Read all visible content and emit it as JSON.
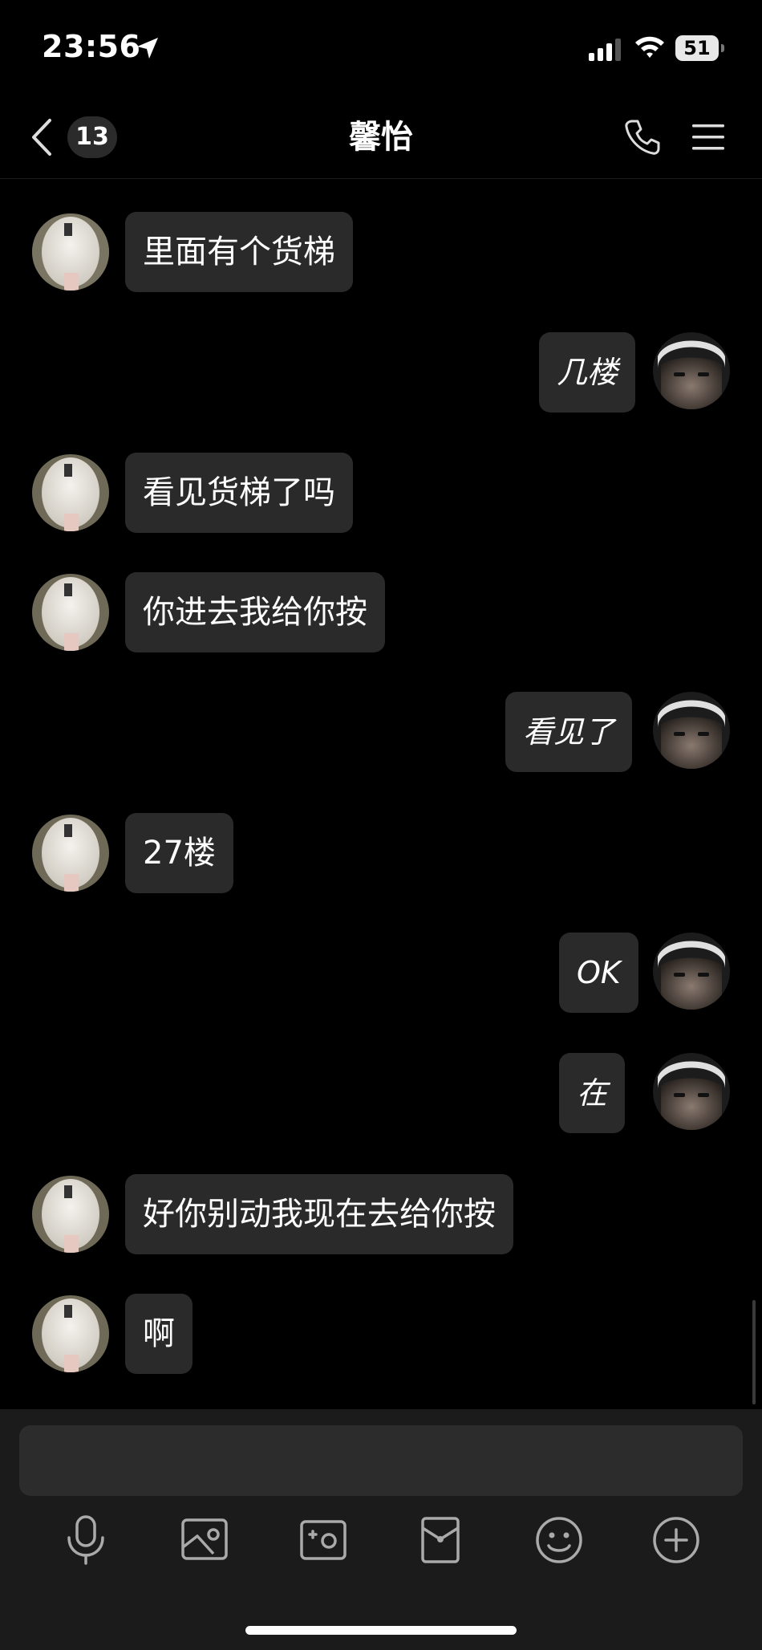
{
  "status_bar": {
    "time": "23:56",
    "battery": "51"
  },
  "nav": {
    "unread_count": "13",
    "title": "馨怡"
  },
  "messages": [
    {
      "side": "left",
      "text": "里面有个货梯"
    },
    {
      "side": "right",
      "text": "几楼"
    },
    {
      "side": "left",
      "text": "看见货梯了吗"
    },
    {
      "side": "left",
      "text": "你进去我给你按"
    },
    {
      "side": "right",
      "text": "看见了"
    },
    {
      "side": "left",
      "text": "27楼"
    },
    {
      "side": "right",
      "text": "OK"
    },
    {
      "side": "right",
      "text": "在"
    },
    {
      "side": "left",
      "text": "好你别动我现在去给你按"
    },
    {
      "side": "left",
      "text": "啊"
    }
  ],
  "input": {
    "placeholder": ""
  },
  "toolbar_icons": [
    "microphone-icon",
    "photo-icon",
    "camera-icon",
    "red-packet-icon",
    "emoji-icon",
    "plus-icon"
  ],
  "colors": {
    "background": "#000000",
    "bubble": "#2a2a2a",
    "input_area": "#1b1b1b"
  }
}
